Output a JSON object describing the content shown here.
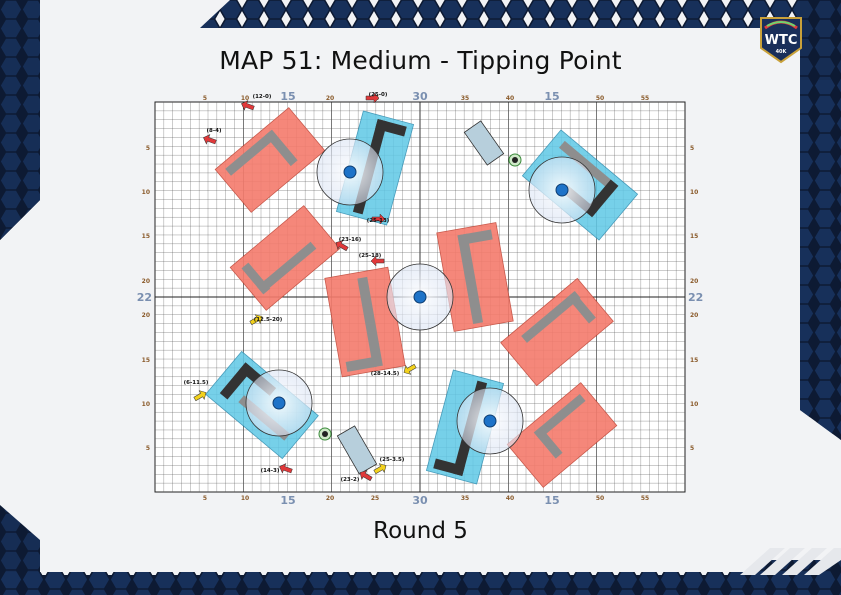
{
  "title": "MAP 51: Medium - Tipping Point",
  "subtitle": "Round 5",
  "logo": {
    "main": "WTC",
    "sub": "40K"
  },
  "colors": {
    "red_zone": "#f47b6c",
    "blue_zone": "#5fc8e6",
    "objective": "#1e73c8",
    "frame": "#0d1a33",
    "hex": "#1f3a66"
  },
  "axis": {
    "top_small": [
      "5",
      "10",
      "20",
      "25",
      "35",
      "40",
      "50",
      "55"
    ],
    "top_big": [
      "15",
      "30",
      "15"
    ],
    "bottom_small": [
      "5",
      "10",
      "20",
      "25",
      "35",
      "40",
      "50",
      "55"
    ],
    "bottom_big": [
      "15",
      "30",
      "15"
    ],
    "left_small": [
      "5",
      "10",
      "15",
      "20",
      "20",
      "15",
      "10",
      "5"
    ],
    "left_big": "22",
    "right_small": [
      "5",
      "10",
      "15",
      "20",
      "20",
      "15",
      "10",
      "5"
    ],
    "right_big": "22"
  },
  "markers": [
    {
      "label": "(12-0)",
      "color": "red"
    },
    {
      "label": "(25-0)",
      "color": "red"
    },
    {
      "label": "(8-4)",
      "color": "red"
    },
    {
      "label": "(25-13)",
      "color": "red"
    },
    {
      "label": "(23-16)",
      "color": "red"
    },
    {
      "label": "(25-18)",
      "color": "red"
    },
    {
      "label": "(12.5-20)",
      "color": "yellow"
    },
    {
      "label": "(28-14.5)",
      "color": "yellow"
    },
    {
      "label": "(6-11.5)",
      "color": "yellow"
    },
    {
      "label": "(14-3)",
      "color": "red"
    },
    {
      "label": "(23-2)",
      "color": "red"
    },
    {
      "label": "(25-3.5)",
      "color": "yellow"
    }
  ],
  "icons": [
    "objective-marker",
    "ruin-wall",
    "tree-area",
    "hex-pattern",
    "arrow-marker",
    "model-token"
  ]
}
